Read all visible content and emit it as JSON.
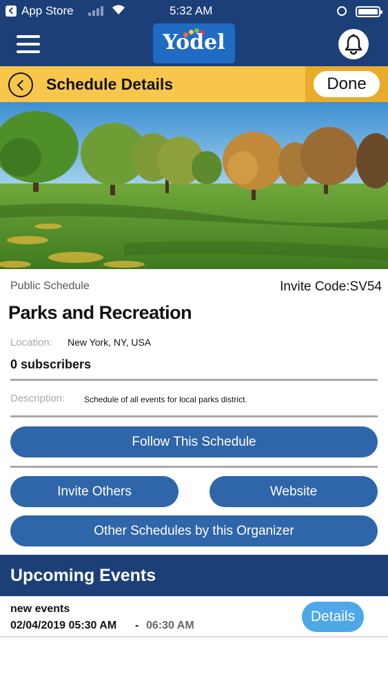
{
  "status_bar": {
    "carrier": "App Store",
    "time": "5:32 AM"
  },
  "nav": {
    "logo_text": "Yodel",
    "icons": {
      "menu": "hamburger-menu-icon",
      "notifications": "bell-icon"
    }
  },
  "header": {
    "title": "Schedule Details",
    "done_label": "Done"
  },
  "schedule": {
    "type": "Public Schedule",
    "invite_code": "Invite Code:SV54",
    "name": "Parks and Recreation",
    "location_label": "Location:",
    "location": "New York, NY, USA",
    "subscribers": "0 subscribers",
    "description_label": "Description:",
    "description": "Schedule of all events for local parks district."
  },
  "actions": {
    "follow": "Follow This Schedule",
    "invite": "Invite Others",
    "website": "Website",
    "other_schedules": "Other Schedules by this Organizer"
  },
  "upcoming": {
    "title": "Upcoming Events",
    "events": [
      {
        "name": "new events",
        "start": "02/04/2019 05:30 AM",
        "separator": "-",
        "end": "06:30 AM",
        "details_label": "Details"
      }
    ]
  },
  "colors": {
    "nav_blue": "#1c3f78",
    "title_yellow": "#f7c64b",
    "done_gold": "#e8ac2a",
    "button_blue": "#2f65a9",
    "details_blue": "#4ea7e6"
  }
}
